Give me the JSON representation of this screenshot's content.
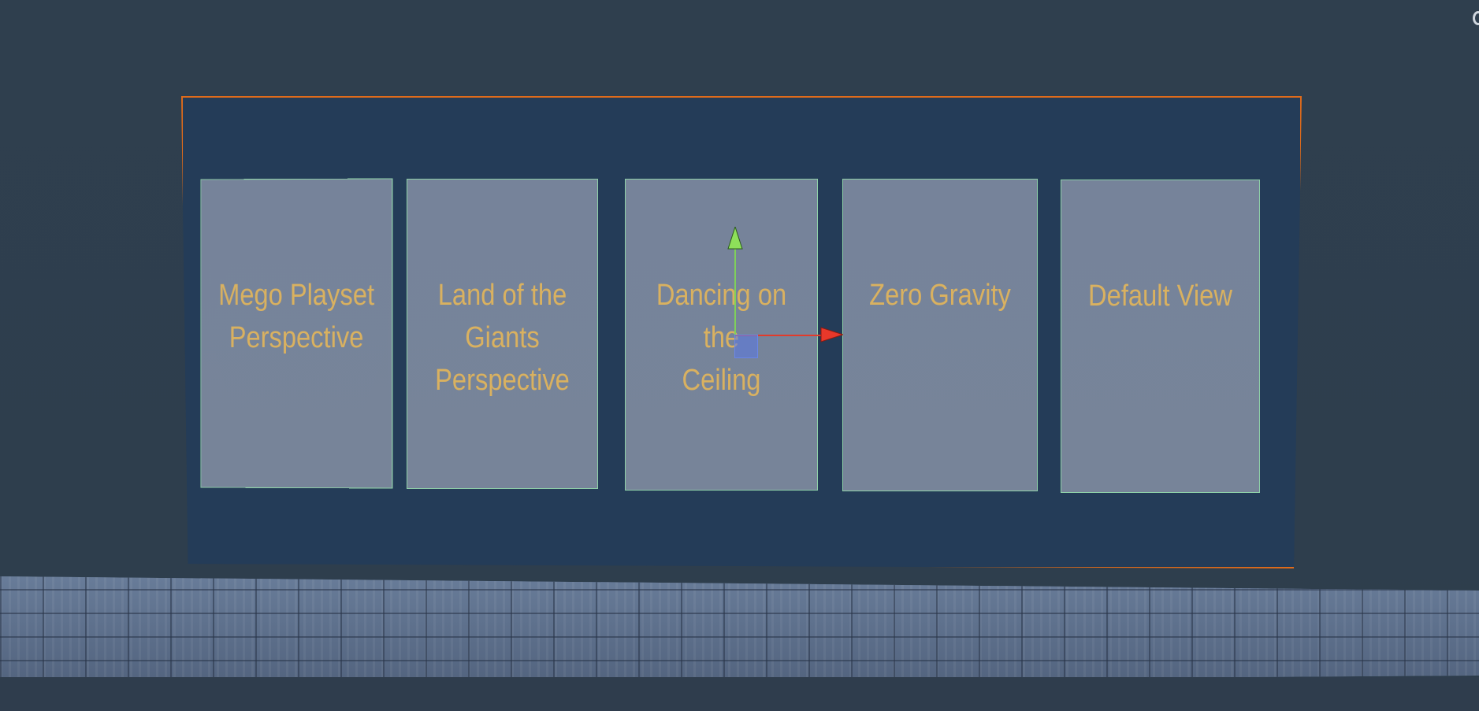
{
  "scene": {
    "cards": [
      {
        "label_lines": [
          "Mego Playset",
          "Perspective"
        ]
      },
      {
        "label_lines": [
          "Land of the",
          "Giants",
          "Perspective"
        ]
      },
      {
        "label_lines": [
          "Dancing on the",
          "Ceiling"
        ]
      },
      {
        "label_lines": [
          "Zero Gravity"
        ]
      },
      {
        "label_lines": [
          "Default View"
        ]
      }
    ],
    "icons": {
      "gizmo_y": "arrow-up-icon",
      "gizmo_x": "arrow-right-icon",
      "gizmo_center": "move-handle-icon"
    },
    "colors": {
      "background": "#2d3e4d",
      "panel": "#243c58",
      "selection_outline": "#e06b1a",
      "card": "#76839a",
      "card_text": "#d9b160",
      "card_outline": "#8fd1a8",
      "gizmo_x": "#e23b2b",
      "gizmo_y": "#7fd05a",
      "gizmo_center": "#5a78e6"
    }
  }
}
